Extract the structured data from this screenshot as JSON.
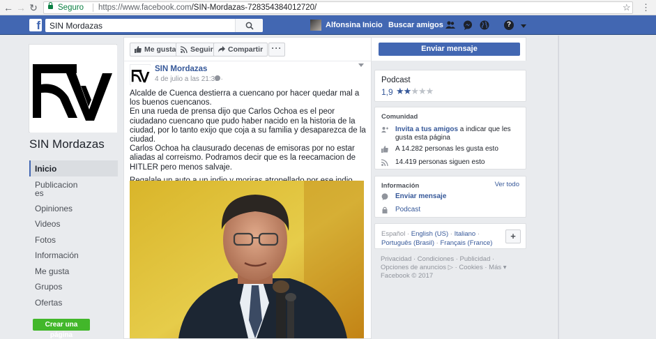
{
  "browser": {
    "secure_label": "Seguro",
    "url_prefix": "https://www.facebook.com",
    "url_path": "/SIN-Mordazas-728354384012720/"
  },
  "topbar": {
    "search_value": "SIN Mordazas",
    "user_name": "Alfonsina",
    "home_label": "Inicio",
    "find_friends_label": "Buscar amigos",
    "help_glyph": "?"
  },
  "page": {
    "name": "SIN Mordazas"
  },
  "leftnav": {
    "items": [
      {
        "label": "Inicio"
      },
      {
        "label": "Publicaciones"
      },
      {
        "label": "Opiniones"
      },
      {
        "label": "Videos"
      },
      {
        "label": "Fotos"
      },
      {
        "label": "Información"
      },
      {
        "label": "Me gusta"
      },
      {
        "label": "Grupos"
      },
      {
        "label": "Ofertas"
      }
    ],
    "create_page_label": "Crear una página"
  },
  "actions": {
    "like_label": "Me gusta",
    "follow_label": "Seguir",
    "share_label": "Compartir",
    "more_label": "···",
    "send_message_label": "Enviar mensaje"
  },
  "post": {
    "author": "SIN Mordazas",
    "date": "4 de julio a las 21:39 ·",
    "paragraphs": [
      "Alcalde de Cuenca destierra a cuencano por hacer quedar mal a los buenos cuencanos.",
      "En una rueda de prensa dijo que Carlos Ochoa es el peor ciudadano cuencano que pudo haber nacido en la historia de la ciudad, por lo tanto exijo que coja a su familia y desaparezca de la ciudad.",
      "Carlos Ochoa ha clausurado decenas de emisoras por no estar aliadas al correismo. Podramos decir que es la reecamacion de HITLER pero menos salvaje.",
      "Regalale un auto a un indio y moriras atropellado por ese indio"
    ]
  },
  "podcast": {
    "title": "Podcast",
    "rating": "1,9",
    "stars_on": 2,
    "stars_total": 5
  },
  "community": {
    "heading": "Comunidad",
    "invite_link": "Invita a tus amigos",
    "invite_rest": " a indicar que les gusta esta página",
    "likes_text": "A 14.282 personas les gusta esto",
    "followers_text": "14.419 personas siguen esto"
  },
  "info": {
    "heading": "Información",
    "see_all": "Ver todo",
    "send_message": "Enviar mensaje",
    "podcast": "Podcast"
  },
  "languages": {
    "current": "Español ·",
    "options": [
      "English (US)",
      "Italiano",
      "Português (Brasil)",
      "Français (France)"
    ],
    "plus": "+"
  },
  "footer": {
    "line1": "Privacidad · Condiciones · Publicidad ·",
    "line2": "Opciones de anuncios ▷ · Cookies · Más ▾",
    "line3": "Facebook © 2017"
  },
  "colors": {
    "fb_blue": "#4267b2",
    "link": "#365899",
    "green": "#42b72a",
    "secure_green": "#0b8043"
  }
}
